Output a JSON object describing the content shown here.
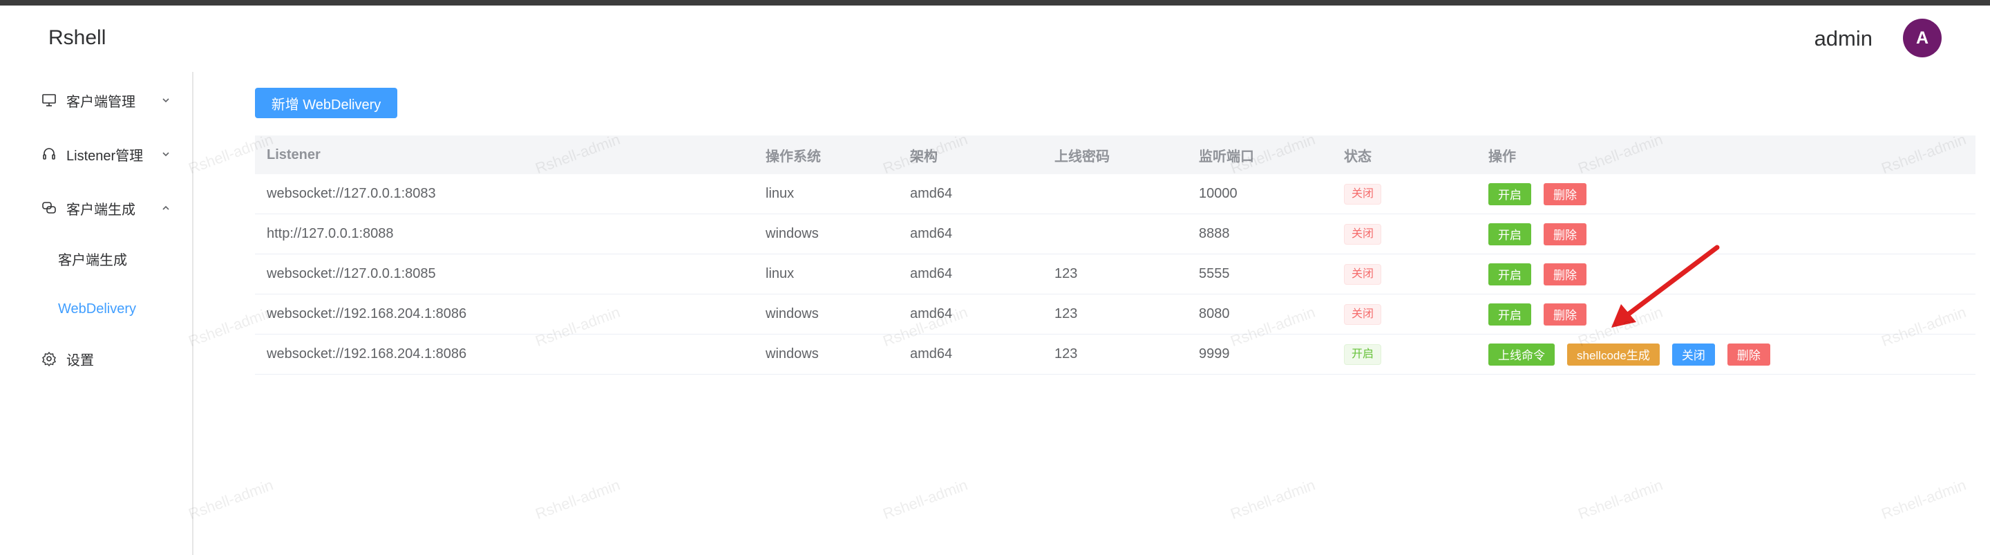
{
  "app": {
    "title": "Rshell"
  },
  "user": {
    "name": "admin",
    "avatar_letter": "A"
  },
  "sidebar": {
    "items": [
      {
        "label": "客户端管理",
        "icon": "monitor-icon"
      },
      {
        "label": "Listener管理",
        "icon": "headset-icon"
      },
      {
        "label": "客户端生成",
        "icon": "chat-icon",
        "expanded": true,
        "children": [
          {
            "label": "客户端生成"
          },
          {
            "label": "WebDelivery",
            "active": true
          }
        ]
      },
      {
        "label": "设置",
        "icon": "gear-icon"
      }
    ]
  },
  "toolbar": {
    "add_label": "新增 WebDelivery"
  },
  "table": {
    "headers": [
      "Listener",
      "操作系统",
      "架构",
      "上线密码",
      "监听端口",
      "状态",
      "操作"
    ],
    "rows": [
      {
        "listener": "websocket://127.0.0.1:8083",
        "os": "linux",
        "arch": "amd64",
        "password": "",
        "port": "10000",
        "status": "关闭",
        "actions": [
          "开启",
          "删除"
        ]
      },
      {
        "listener": "http://127.0.0.1:8088",
        "os": "windows",
        "arch": "amd64",
        "password": "",
        "port": "8888",
        "status": "关闭",
        "actions": [
          "开启",
          "删除"
        ]
      },
      {
        "listener": "websocket://127.0.0.1:8085",
        "os": "linux",
        "arch": "amd64",
        "password": "123",
        "port": "5555",
        "status": "关闭",
        "actions": [
          "开启",
          "删除"
        ]
      },
      {
        "listener": "websocket://192.168.204.1:8086",
        "os": "windows",
        "arch": "amd64",
        "password": "123",
        "port": "8080",
        "status": "关闭",
        "actions": [
          "开启",
          "删除"
        ]
      },
      {
        "listener": "websocket://192.168.204.1:8086",
        "os": "windows",
        "arch": "amd64",
        "password": "123",
        "port": "9999",
        "status": "开启",
        "actions": [
          "上线命令",
          "shellcode生成",
          "关闭",
          "删除"
        ]
      }
    ]
  },
  "watermark": "Rshell-admin",
  "colors": {
    "accent": "#409eff",
    "success": "#67c23a",
    "danger": "#f56c6c",
    "warning": "#e6a23c",
    "avatar": "#6e1a6b",
    "arrow": "#e02020"
  }
}
